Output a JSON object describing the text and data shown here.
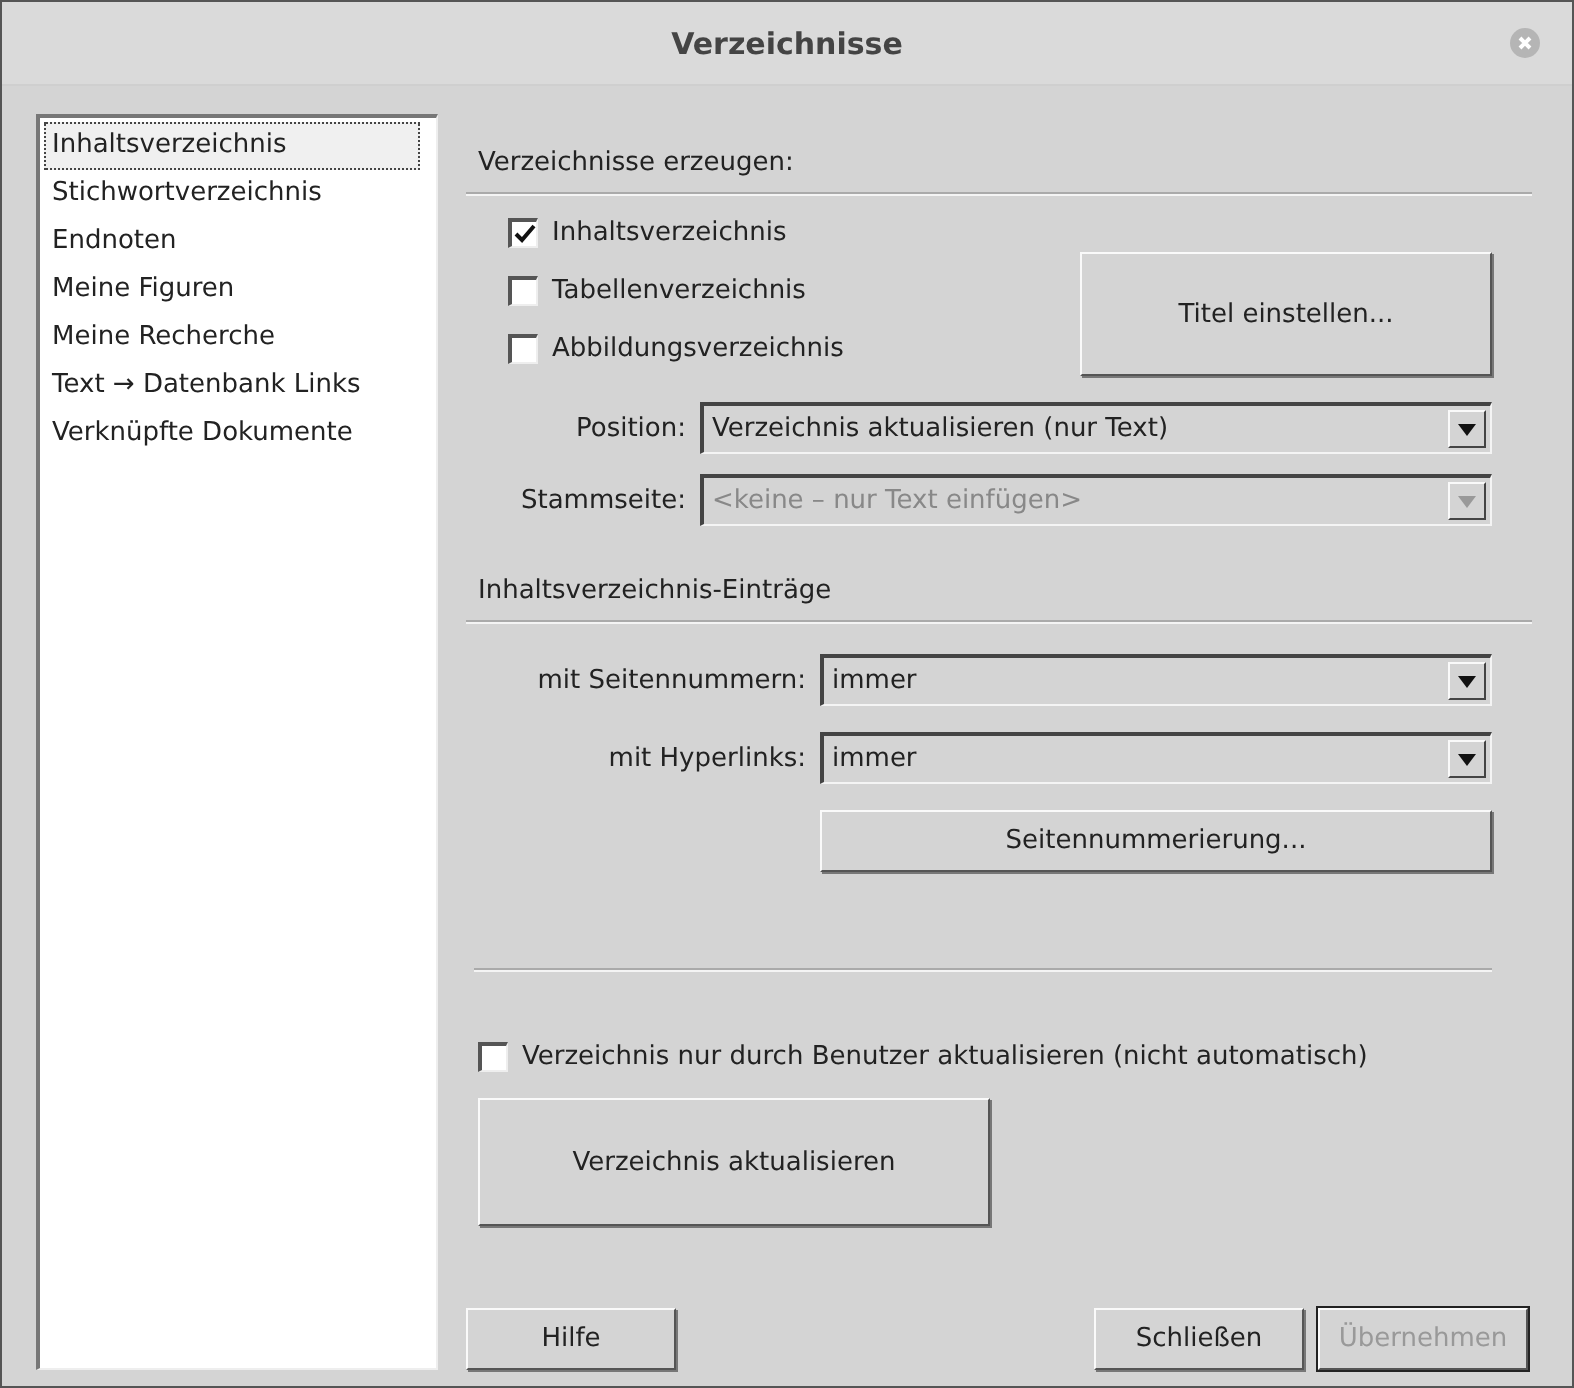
{
  "window": {
    "title": "Verzeichnisse"
  },
  "sidebar": {
    "items": [
      {
        "label": "Inhaltsverzeichnis",
        "selected": true
      },
      {
        "label": "Stichwortverzeichnis",
        "selected": false
      },
      {
        "label": "Endnoten",
        "selected": false
      },
      {
        "label": "Meine Figuren",
        "selected": false
      },
      {
        "label": "Meine Recherche",
        "selected": false
      },
      {
        "label": "Text → Datenbank Links",
        "selected": false
      },
      {
        "label": "Verknüpfte Dokumente",
        "selected": false
      }
    ]
  },
  "create_section": {
    "heading": "Verzeichnisse erzeugen:",
    "checkboxes": [
      {
        "label": "Inhaltsverzeichnis",
        "checked": true
      },
      {
        "label": "Tabellenverzeichnis",
        "checked": false
      },
      {
        "label": "Abbildungsverzeichnis",
        "checked": false
      }
    ],
    "title_button": {
      "label": "Titel einstellen..."
    },
    "position": {
      "label": "Position:",
      "value": "Verzeichnis aktualisieren (nur Text)",
      "disabled": false
    },
    "master_page": {
      "label": "Stammseite:",
      "value": "<keine – nur Text einfügen>",
      "disabled": true
    }
  },
  "entries_section": {
    "heading": "Inhaltsverzeichnis-Einträge",
    "page_numbers": {
      "label": "mit Seitennummern:",
      "value": "immer",
      "disabled": false
    },
    "hyperlinks": {
      "label": "mit Hyperlinks:",
      "value": "immer",
      "disabled": false
    },
    "numbering_button": {
      "label": "Seitennummerierung..."
    }
  },
  "manual_update": {
    "label": "Verzeichnis nur durch Benutzer aktualisieren (nicht automatisch)",
    "checked": false
  },
  "update_button": {
    "label": "Verzeichnis aktualisieren"
  },
  "buttons": [
    {
      "label": "Hilfe",
      "disabled": false,
      "default": false
    },
    {
      "label": "Schließen",
      "disabled": false,
      "default": false
    },
    {
      "label": "Übernehmen",
      "disabled": true,
      "default": true
    }
  ]
}
